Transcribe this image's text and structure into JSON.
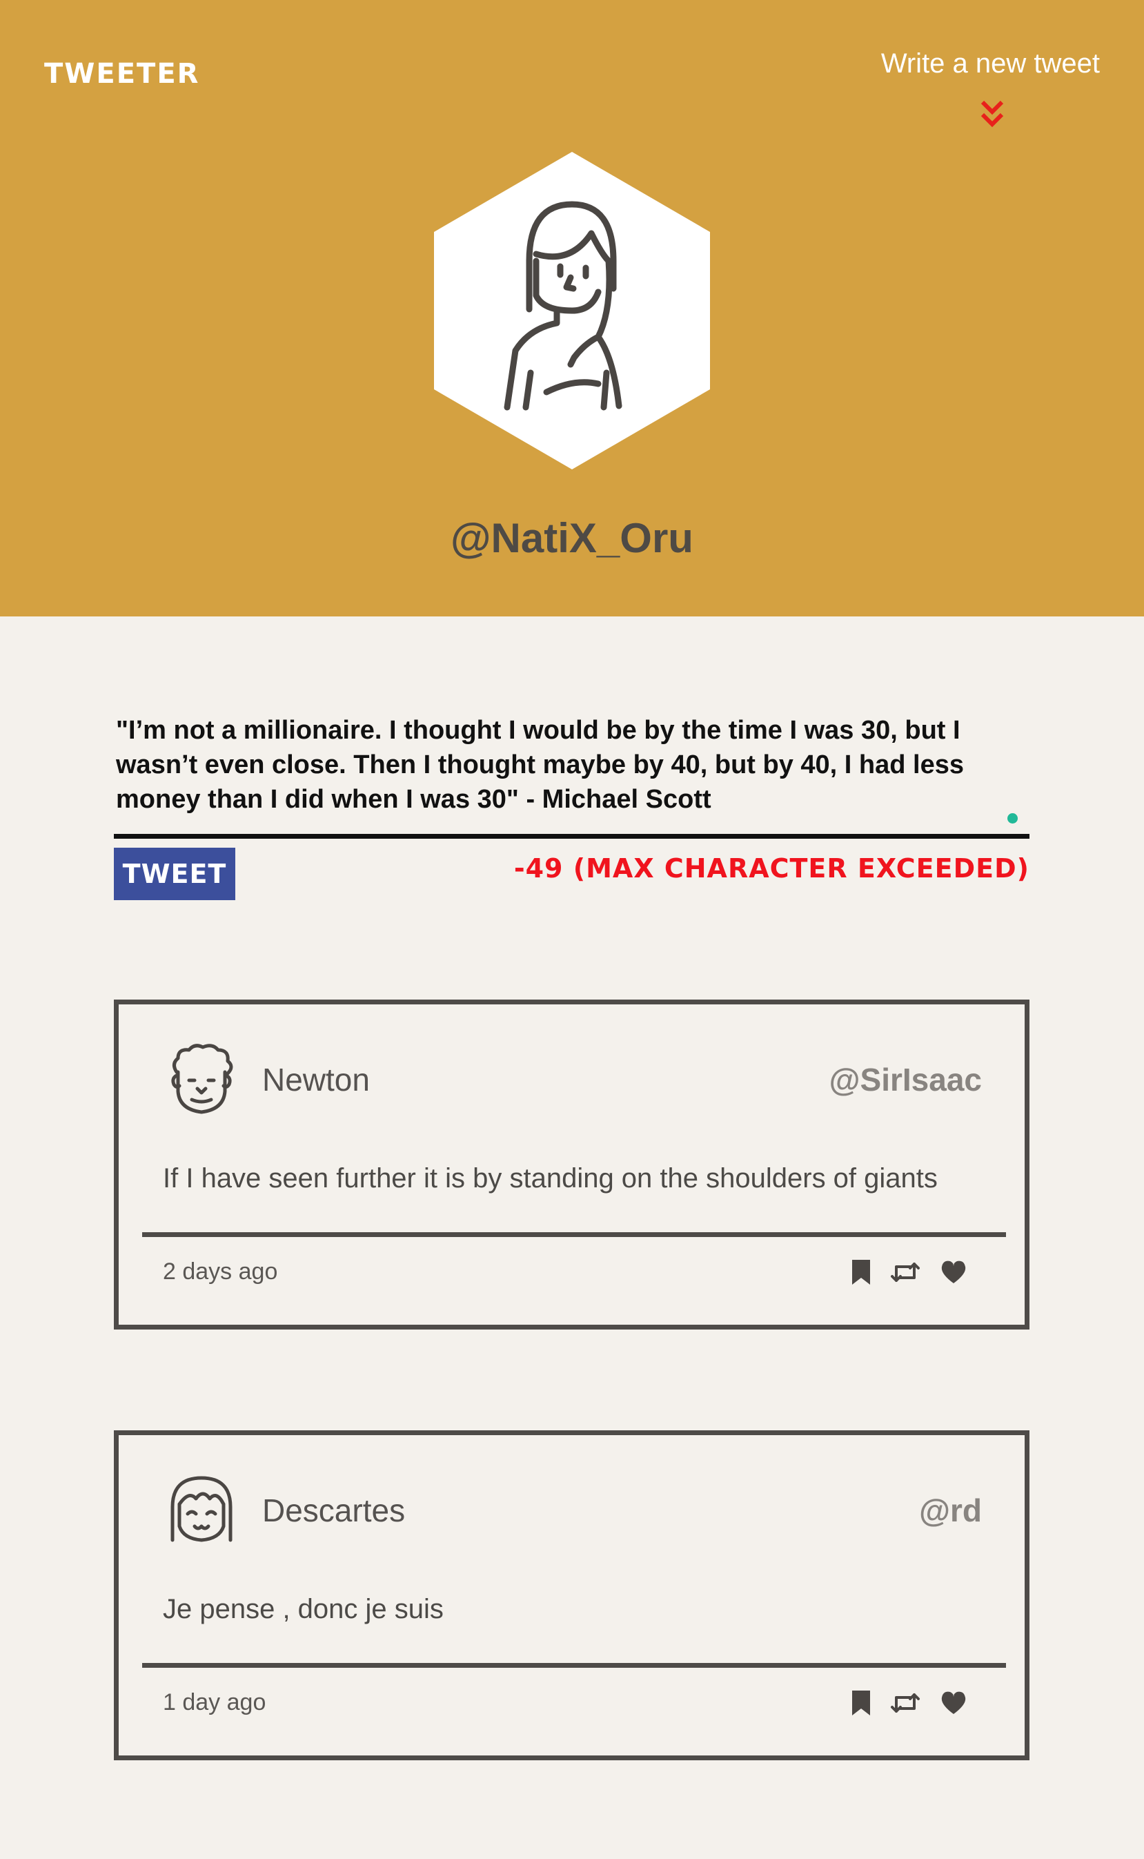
{
  "header": {
    "logo": "TWEETER",
    "write_link": "Write a new tweet",
    "username": "@NatiX_Oru"
  },
  "composer": {
    "text": "\"I’m not a millionaire. I thought I would be by the time I was 30, but I wasn’t even close. Then I thought maybe by 40, but by 40, I had less money than I did when I was 30\" - Michael Scott",
    "tweet_button": "TWEET",
    "counter": "-49 (MAX CHARACTER EXCEEDED)"
  },
  "tweets": [
    {
      "name": "Newton",
      "handle": "@SirIsaac",
      "text": "If I have seen further it is by standing on the shoulders of giants",
      "time": "2 days ago",
      "avatar_icon": "curly-haired-man-avatar-icon"
    },
    {
      "name": "Descartes",
      "handle": "@rd",
      "text": "Je pense , donc je suis",
      "time": "1 day ago",
      "avatar_icon": "bob-haired-person-avatar-icon"
    }
  ],
  "colors": {
    "header_bg": "#d4a141",
    "page_bg": "#f4f1ec",
    "tweet_button_bg": "#3c4f9c",
    "counter_error": "#f0141e",
    "status_dot": "#21b998"
  }
}
